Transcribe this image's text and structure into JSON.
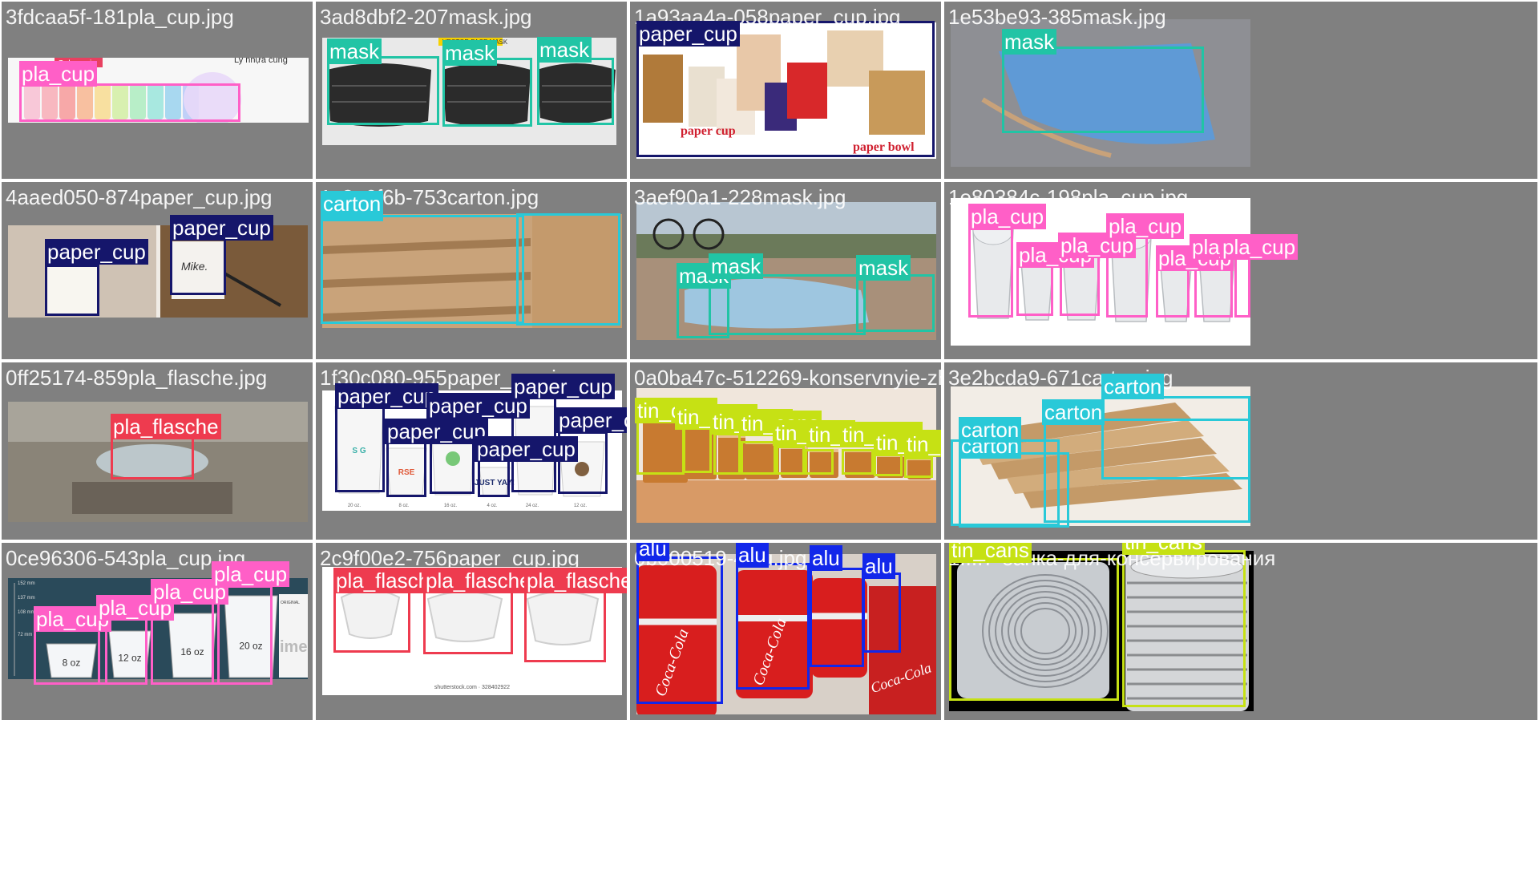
{
  "grid": {
    "rows": 4,
    "cols": 4
  },
  "class_colors": {
    "pla_cup": "#ff5fc7",
    "mask": "#21c4a5",
    "paper_cup": "#15166b",
    "carton": "#29c9d8",
    "pla_flasche": "#ee3b4f",
    "tin_cans": "#c6e114",
    "alu": "#1227ea"
  },
  "tiles": [
    {
      "filename": "3fdcaa5f-181pla_cup.jpg",
      "texts": {
        "t1": "Gel ngayi",
        "t2": "Ly nhựa cung"
      },
      "detections": [
        {
          "label": "pla_cup",
          "cls": "pla_cup"
        }
      ]
    },
    {
      "filename": "3ad8dbf2-207mask.jpg",
      "texts": {
        "t1": "VECTOR FACE MASK"
      },
      "detections": [
        {
          "label": "mask",
          "cls": "mask"
        },
        {
          "label": "mask",
          "cls": "mask"
        },
        {
          "label": "mask",
          "cls": "mask"
        }
      ]
    },
    {
      "filename": "1a93aa4a-058paper_cup.jpg",
      "texts": {
        "t1": "paper cup",
        "t2": "paper bowl"
      },
      "detections": [
        {
          "label": "paper_cup",
          "cls": "paper_cup"
        }
      ]
    },
    {
      "filename": "1e53be93-385mask.jpg",
      "texts": {},
      "detections": [
        {
          "label": "mask",
          "cls": "mask"
        }
      ]
    },
    {
      "filename": "4aaed050-874paper_cup.jpg",
      "texts": {
        "t1": "Mike."
      },
      "detections": [
        {
          "label": "paper_cup",
          "cls": "paper_cup"
        },
        {
          "label": "paper_cup",
          "cls": "paper_cup"
        }
      ]
    },
    {
      "filename": "1c2a6f6b-753carton.jpg",
      "texts": {},
      "detections": [
        {
          "label": "carton",
          "cls": "carton"
        },
        {
          "label": "carton",
          "cls": "carton"
        }
      ]
    },
    {
      "filename": "3aef90a1-228mask.jpg",
      "texts": {},
      "detections": [
        {
          "label": "mask",
          "cls": "mask"
        },
        {
          "label": "mask",
          "cls": "mask"
        },
        {
          "label": "mask",
          "cls": "mask"
        }
      ]
    },
    {
      "filename": "1e80384c-198pla_cup.jpg",
      "texts": {},
      "detections": [
        {
          "label": "pla_cup",
          "cls": "pla_cup"
        },
        {
          "label": "pla_cup",
          "cls": "pla_cup"
        },
        {
          "label": "pla_cup",
          "cls": "pla_cup"
        },
        {
          "label": "pla_cup",
          "cls": "pla_cup"
        },
        {
          "label": "pla_cup",
          "cls": "pla_cup"
        },
        {
          "label": "pla_cup",
          "cls": "pla_cup"
        },
        {
          "label": "pla_cup",
          "cls": "pla_cup"
        }
      ]
    },
    {
      "filename": "0ff25174-859pla_flasche.jpg",
      "texts": {},
      "detections": [
        {
          "label": "pla_flasche",
          "cls": "pla_flasche"
        }
      ]
    },
    {
      "filename": "1f30c080-955paper_cup.jpg",
      "texts": {
        "t1": "S G",
        "t2": "RSE",
        "t3": "JUST YAY!",
        "t4": "20 oz.",
        "t5": "8 oz.",
        "t6": "16 oz.",
        "t7": "4 oz.",
        "t8": "24 oz.",
        "t9": "12 oz."
      },
      "detections": [
        {
          "label": "paper_cup",
          "cls": "paper_cup"
        },
        {
          "label": "paper_cup",
          "cls": "paper_cup"
        },
        {
          "label": "paper_cup",
          "cls": "paper_cup"
        },
        {
          "label": "paper_cup",
          "cls": "paper_cup"
        },
        {
          "label": "paper_cup",
          "cls": "paper_cup"
        },
        {
          "label": "paper_cup",
          "cls": "paper_cup"
        }
      ]
    },
    {
      "filename": "0a0ba47c-512269-konservnyie-zhiestianki",
      "texts": {},
      "detections": [
        {
          "label": "tin_cans",
          "cls": "tin_cans"
        },
        {
          "label": "tin_cans",
          "cls": "tin_cans"
        },
        {
          "label": "tin_cans",
          "cls": "tin_cans"
        },
        {
          "label": "tin_cans",
          "cls": "tin_cans"
        },
        {
          "label": "tin_cans",
          "cls": "tin_cans"
        },
        {
          "label": "tin_cans",
          "cls": "tin_cans"
        },
        {
          "label": "tin_cans",
          "cls": "tin_cans"
        },
        {
          "label": "tin_cans",
          "cls": "tin_cans"
        },
        {
          "label": "tin_cans",
          "cls": "tin_cans"
        }
      ]
    },
    {
      "filename": "3e2bcda9-671carton.jpg",
      "texts": {},
      "detections": [
        {
          "label": "carton",
          "cls": "carton"
        },
        {
          "label": "carton",
          "cls": "carton"
        },
        {
          "label": "carton",
          "cls": "carton"
        },
        {
          "label": "carton",
          "cls": "carton"
        }
      ]
    },
    {
      "filename": "0ce96306-543pla_cup.jpg",
      "texts": {
        "t1": "8 oz",
        "t2": "12 oz",
        "t3": "16 oz",
        "t4": "20 oz",
        "t5": "152 mm",
        "t6": "137 mm",
        "t7": "108 mm",
        "t8": "72 mm",
        "t9": "ORIGINAL",
        "t10": "ime"
      },
      "detections": [
        {
          "label": "pla_cup",
          "cls": "pla_cup"
        },
        {
          "label": "pla_cup",
          "cls": "pla_cup"
        },
        {
          "label": "pla_cup",
          "cls": "pla_cup"
        },
        {
          "label": "pla_cup",
          "cls": "pla_cup"
        }
      ]
    },
    {
      "filename": "2c9f00e2-756paper_cup.jpg",
      "texts": {
        "t1": "shutterstock.com · 328402922"
      },
      "detections": [
        {
          "label": "pla_flasche",
          "cls": "pla_flasche"
        },
        {
          "label": "pla_flasche",
          "cls": "pla_flasche"
        },
        {
          "label": "pla_flasche",
          "cls": "pla_flasche"
        }
      ]
    },
    {
      "filename": "0b000519-4alu.jpg",
      "texts": {
        "t1": "Coca-Cola",
        "t2": "Coca-Cola",
        "t3": "Coca-Cola"
      },
      "detections": [
        {
          "label": "alu",
          "cls": "alu"
        },
        {
          "label": "alu",
          "cls": "alu"
        },
        {
          "label": "alu",
          "cls": "alu"
        },
        {
          "label": "alu",
          "cls": "alu"
        }
      ]
    },
    {
      "filename": "1f...7-банка-для-консервирования",
      "texts": {},
      "detections": [
        {
          "label": "tin_cans",
          "cls": "tin_cans"
        },
        {
          "label": "tin_cans",
          "cls": "tin_cans"
        }
      ]
    }
  ]
}
